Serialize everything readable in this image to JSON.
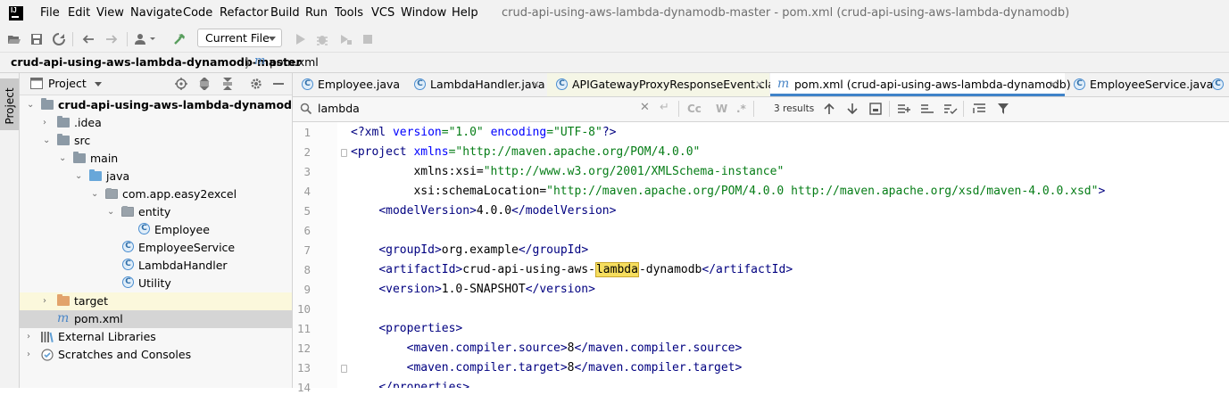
{
  "menu": {
    "items": [
      "File",
      "Edit",
      "View",
      "Navigate",
      "Code",
      "Refactor",
      "Build",
      "Run",
      "Tools",
      "VCS",
      "Window",
      "Help"
    ],
    "window_title": "crud-api-using-aws-lambda-dynamodb-master - pom.xml (crud-api-using-aws-lambda-dynamodb)"
  },
  "toolbar": {
    "run_config": "Current File"
  },
  "navbar": {
    "project": "crud-api-using-aws-lambda-dynamodb-master",
    "file_icon": "m",
    "file": "pom.xml"
  },
  "stripe": {
    "project_label": "Project"
  },
  "project_panel": {
    "title": "Project",
    "tree": [
      {
        "label": "crud-api-using-aws-lambda-dynamodb-master",
        "bold": true,
        "icon": "folder-icon",
        "arrow": "expanded"
      },
      {
        "label": ".idea",
        "icon": "folder-icon",
        "arrow": "collapsed"
      },
      {
        "label": "src",
        "icon": "folder-icon",
        "arrow": "expanded"
      },
      {
        "label": "main",
        "icon": "folder-icon",
        "arrow": "expanded"
      },
      {
        "label": "java",
        "icon": "source-folder-icon",
        "arrow": "expanded"
      },
      {
        "label": "com.app.easy2excel",
        "icon": "package-icon",
        "arrow": "expanded"
      },
      {
        "label": "entity",
        "icon": "package-icon",
        "arrow": "expanded"
      },
      {
        "label": "Employee",
        "icon": "class-icon",
        "arrow": "none"
      },
      {
        "label": "EmployeeService",
        "icon": "class-icon",
        "arrow": "none"
      },
      {
        "label": "LambdaHandler",
        "icon": "class-icon",
        "arrow": "none"
      },
      {
        "label": "Utility",
        "icon": "class-icon",
        "arrow": "none"
      },
      {
        "label": "target",
        "icon": "excluded-folder-icon",
        "arrow": "collapsed"
      },
      {
        "label": "pom.xml",
        "icon": "maven-file-icon",
        "arrow": "none",
        "selected": true
      },
      {
        "label": "External Libraries",
        "icon": "libraries-icon",
        "arrow": "collapsed"
      },
      {
        "label": "Scratches and Consoles",
        "icon": "scratches-icon",
        "arrow": "collapsed"
      }
    ]
  },
  "tabs": [
    {
      "label": "Employee.java",
      "icon": "class-icon"
    },
    {
      "label": "LambdaHandler.java",
      "icon": "class-icon"
    },
    {
      "label": "APIGatewayProxyResponseEvent.class",
      "icon": "class-icon"
    },
    {
      "label": "pom.xml (crud-api-using-aws-lambda-dynamodb)",
      "icon": "maven-file-icon",
      "active": true
    },
    {
      "label": "EmployeeService.java",
      "icon": "class-icon"
    }
  ],
  "search": {
    "query": "lambda",
    "results": "3 results",
    "case_label": "Cc",
    "word_label": "W",
    "regex_label": ".*"
  },
  "editor": {
    "line_numbers": [
      "1",
      "2",
      "3",
      "4",
      "5",
      "6",
      "7",
      "8",
      "9",
      "10",
      "11",
      "12",
      "13",
      "14"
    ],
    "lines": [
      "<?xml version=\"1.0\" encoding=\"UTF-8\"?>",
      "<project xmlns=\"http://maven.apache.org/POM/4.0.0\"",
      "         xmlns:xsi=\"http://www.w3.org/2001/XMLSchema-instance\"",
      "         xsi:schemaLocation=\"http://maven.apache.org/POM/4.0.0 http://maven.apache.org/xsd/maven-4.0.0.xsd\">",
      "    <modelVersion>4.0.0</modelVersion>",
      "",
      "    <groupId>org.example</groupId>",
      "    <artifactId>crud-api-using-aws-lambda-dynamodb</artifactId>",
      "    <version>1.0-SNAPSHOT</version>",
      "",
      "    <properties>",
      "        <maven.compiler.source>8</maven.compiler.source>",
      "        <maven.compiler.target>8</maven.compiler.target>",
      "    </properties>"
    ],
    "highlight_term": "lambda"
  },
  "colors": {
    "accent": "#4083c9",
    "tag": "#000080",
    "attribute": "#0000ff",
    "string": "#067d17",
    "namespace": "#871094",
    "search_highlight": "#f6de5e",
    "selection": "#d5d5d5"
  }
}
